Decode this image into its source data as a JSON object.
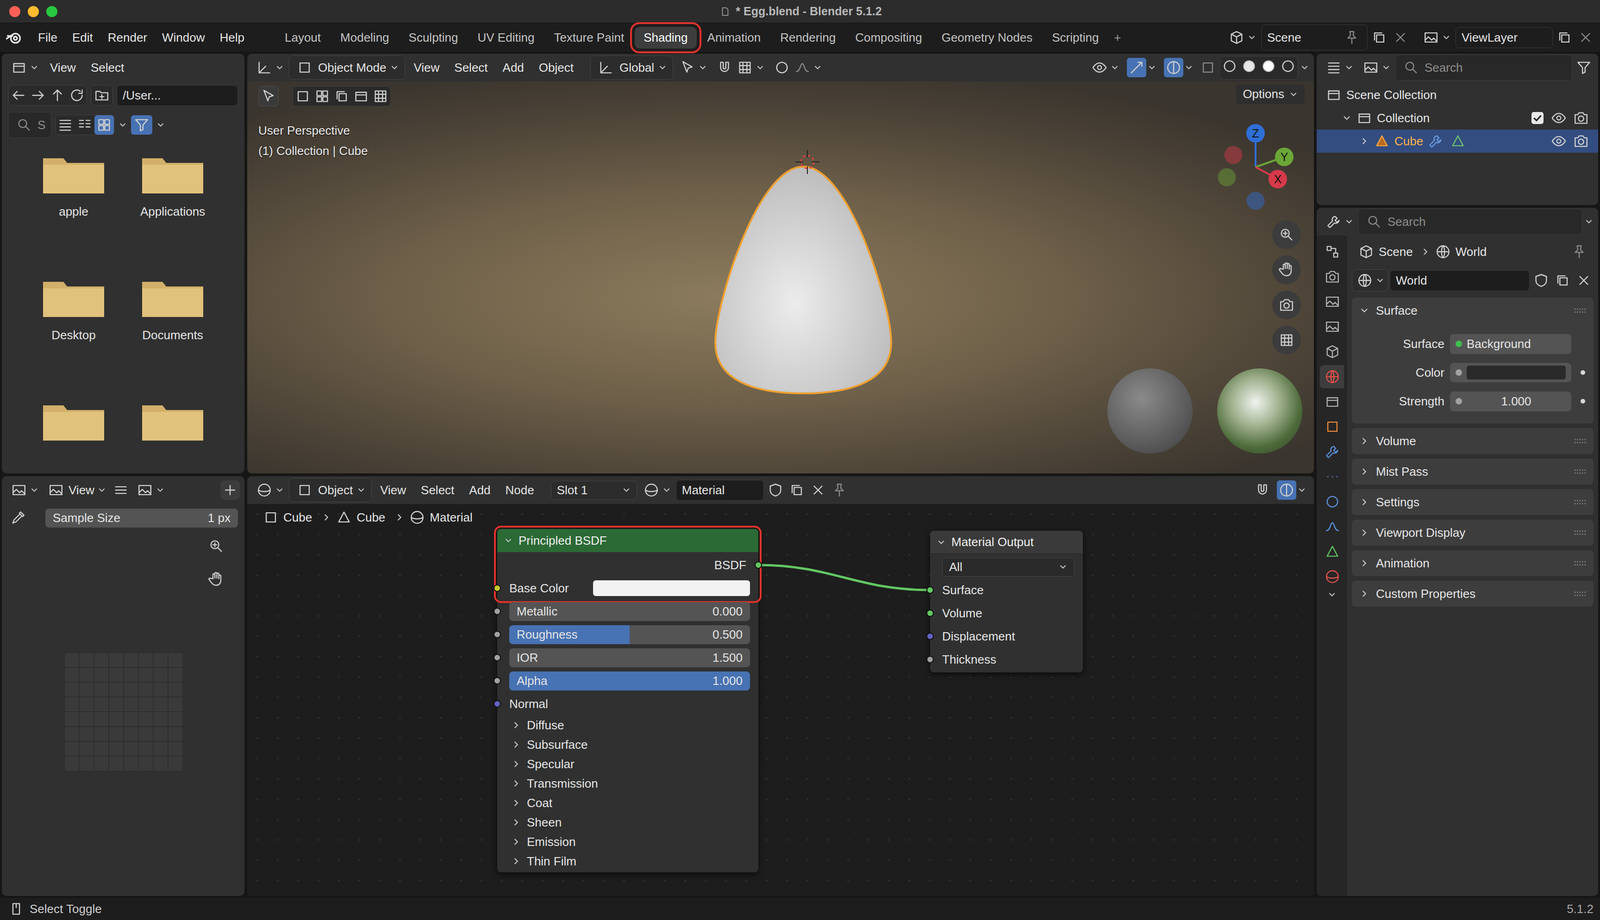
{
  "window": {
    "title": "* Egg.blend - Blender 5.1.2"
  },
  "menu": [
    "File",
    "Edit",
    "Render",
    "Window",
    "Help"
  ],
  "workspaces": [
    {
      "label": "Layout",
      "selected": false,
      "highlighted": false
    },
    {
      "label": "Modeling",
      "selected": false,
      "highlighted": false
    },
    {
      "label": "Sculpting",
      "selected": false,
      "highlighted": false
    },
    {
      "label": "UV Editing",
      "selected": false,
      "highlighted": false
    },
    {
      "label": "Texture Paint",
      "selected": false,
      "highlighted": false
    },
    {
      "label": "Shading",
      "selected": true,
      "highlighted": true
    },
    {
      "label": "Animation",
      "selected": false,
      "highlighted": false
    },
    {
      "label": "Rendering",
      "selected": false,
      "highlighted": false
    },
    {
      "label": "Compositing",
      "selected": false,
      "highlighted": false
    },
    {
      "label": "Geometry Nodes",
      "selected": false,
      "highlighted": false
    },
    {
      "label": "Scripting",
      "selected": false,
      "highlighted": false
    }
  ],
  "add_workspace": "+",
  "scene": "Scene",
  "view_layer": "ViewLayer",
  "file_browser": {
    "menu": [
      "View",
      "Select"
    ],
    "path": "/User...",
    "search": "S",
    "folders": [
      {
        "name": "apple",
        "cut": false
      },
      {
        "name": "Applications",
        "cut": false
      },
      {
        "name": "Desktop",
        "cut": false
      },
      {
        "name": "Documents",
        "cut": false
      },
      {
        "name": "",
        "cut": true
      },
      {
        "name": "",
        "cut": true
      }
    ]
  },
  "viewport": {
    "mode": "Object Mode",
    "menu": [
      "View",
      "Select",
      "Add",
      "Object"
    ],
    "orientation": "Global",
    "options": "Options",
    "overlay": [
      "User Perspective",
      "(1) Collection | Cube"
    ],
    "axes": [
      {
        "label": "Z",
        "color": "#2f6fd6"
      },
      {
        "label": "Y",
        "color": "#6ba637"
      },
      {
        "label": "X",
        "color": "#d63a4a"
      }
    ],
    "shading": [
      {
        "selected": false
      },
      {
        "selected": false
      },
      {
        "selected": true
      },
      {
        "selected": false
      }
    ]
  },
  "outliner": {
    "search": "Search",
    "items": [
      {
        "label": "Scene Collection",
        "depth": 0,
        "kind": "scene",
        "selected": false,
        "expanded": false
      },
      {
        "label": "Collection",
        "depth": 1,
        "kind": "collection",
        "selected": false,
        "expanded": true
      },
      {
        "label": "Cube",
        "depth": 2,
        "kind": "object",
        "selected": true,
        "expanded": false
      }
    ]
  },
  "properties": {
    "search": "Search",
    "breadcrumb": [
      "Scene",
      "World"
    ],
    "world": "World",
    "tabs": [
      {
        "selected": false,
        "color": "#c8c8c8"
      },
      {
        "selected": false,
        "color": "#b0b0b0"
      },
      {
        "selected": false,
        "color": "#b0b0b0"
      },
      {
        "selected": false,
        "color": "#b0b0b0"
      },
      {
        "selected": false,
        "color": "#b0b0b0"
      },
      {
        "selected": true,
        "color": "#e0504a"
      },
      {
        "selected": false,
        "color": "#b0b0b0"
      },
      {
        "selected": false,
        "color": "#e8883a"
      },
      {
        "selected": false,
        "color": "#5a8fd8"
      },
      {
        "selected": false,
        "color": "#5a8fd8"
      },
      {
        "selected": false,
        "color": "#5a8fd8"
      },
      {
        "selected": false,
        "color": "#5a8fd8"
      },
      {
        "selected": false,
        "color": "#5fbf5f"
      },
      {
        "selected": false,
        "color": "#e0504a"
      }
    ],
    "panels": [
      {
        "label": "Surface",
        "expanded": true
      },
      {
        "label": "Volume",
        "expanded": false
      },
      {
        "label": "Mist Pass",
        "expanded": false
      },
      {
        "label": "Settings",
        "expanded": false
      },
      {
        "label": "Viewport Display",
        "expanded": false
      },
      {
        "label": "Animation",
        "expanded": false
      },
      {
        "label": "Custom Properties",
        "expanded": false
      }
    ],
    "surface_rows": [
      {
        "kind": "shader",
        "label": "Surface",
        "value": "Background"
      },
      {
        "kind": "color",
        "label": "Color",
        "swatch": "#2a2a2a"
      },
      {
        "kind": "number",
        "label": "Strength",
        "value": "1.000"
      }
    ]
  },
  "image_editor": {
    "view": "View",
    "sample_label": "Sample Size",
    "sample_value": "1 px"
  },
  "node_editor": {
    "object": "Object",
    "menu": [
      "View",
      "Select",
      "Add",
      "Node"
    ],
    "slot": "Slot 1",
    "material": "Material",
    "breadcrumb": [
      "Cube",
      "Cube",
      "Material"
    ],
    "nodes": [
      {
        "title": "Principled BSDF",
        "kind": "shader",
        "highlighted": true,
        "rows": [
          {
            "kind": "output",
            "label": "BSDF",
            "socket": "#63c763"
          },
          {
            "kind": "color",
            "label": "Base Color",
            "socket": "#c7c729",
            "swatch": "#f2f2f2"
          },
          {
            "kind": "slider",
            "label": "Metallic",
            "value": "0.000",
            "level": 0,
            "socket": "#a1a1a1"
          },
          {
            "kind": "slider",
            "label": "Roughness",
            "value": "0.500",
            "level": 0.5,
            "socket": "#a1a1a1"
          },
          {
            "kind": "field",
            "label": "IOR",
            "value": "1.500",
            "socket": "#a1a1a1"
          },
          {
            "kind": "slider",
            "label": "Alpha",
            "value": "1.000",
            "level": 1,
            "socket": "#a1a1a1"
          },
          {
            "kind": "vector",
            "label": "Normal",
            "socket": "#6363c7"
          },
          {
            "kind": "panel",
            "label": "Diffuse",
            "expanded": false
          },
          {
            "kind": "panel",
            "label": "Subsurface",
            "expanded": false
          },
          {
            "kind": "panel",
            "label": "Specular",
            "expanded": false
          },
          {
            "kind": "panel",
            "label": "Transmission",
            "expanded": false
          },
          {
            "kind": "panel",
            "label": "Coat",
            "expanded": false
          },
          {
            "kind": "panel",
            "label": "Sheen",
            "expanded": false
          },
          {
            "kind": "panel",
            "label": "Emission",
            "expanded": false
          },
          {
            "kind": "panel",
            "label": "Thin Film",
            "expanded": false
          }
        ]
      },
      {
        "title": "Material Output",
        "kind": "output",
        "highlighted": false,
        "rows": [
          {
            "kind": "dropdown",
            "label": "All"
          },
          {
            "kind": "input",
            "label": "Surface",
            "socket": "#63c763"
          },
          {
            "kind": "input",
            "label": "Volume",
            "socket": "#63c763"
          },
          {
            "kind": "input",
            "label": "Displacement",
            "socket": "#6363c7"
          },
          {
            "kind": "input",
            "label": "Thickness",
            "socket": "#a1a1a1"
          }
        ]
      }
    ],
    "links": [
      {
        "from": "BSDF",
        "to": "Surface",
        "color": "#63c763"
      }
    ]
  },
  "status_bar": {
    "hint": "Select Toggle",
    "version": "5.1.2"
  }
}
